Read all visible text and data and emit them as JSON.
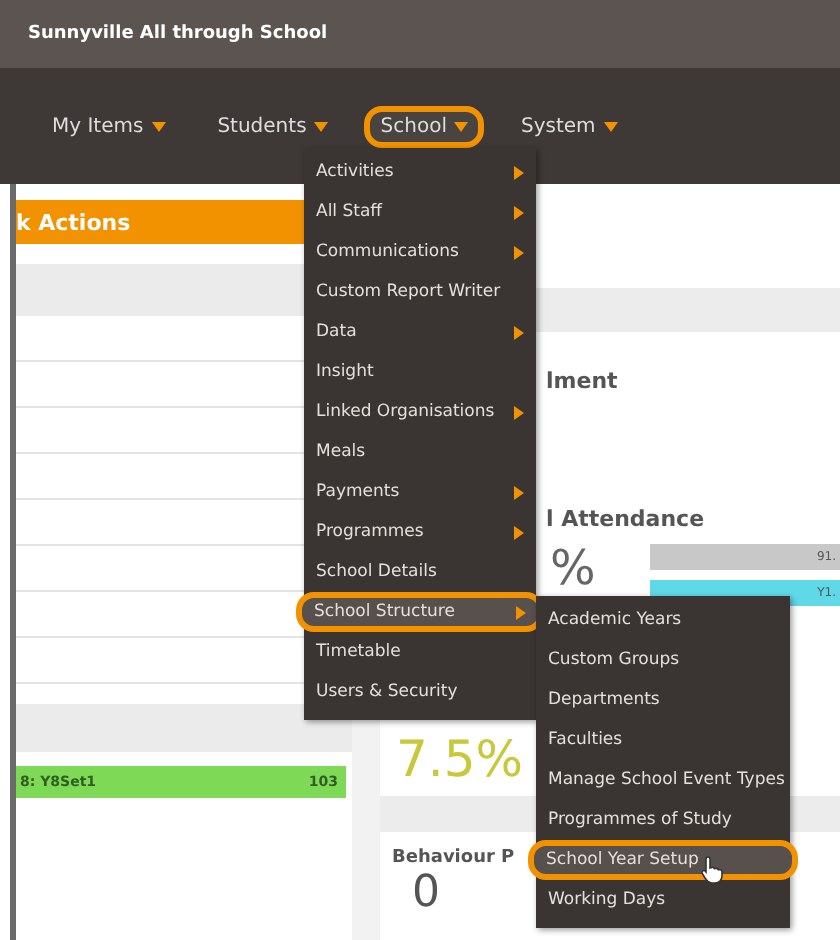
{
  "window": {
    "title": "Sunnyville All through School"
  },
  "nav": [
    {
      "label": "My Items",
      "highlighted": false
    },
    {
      "label": "Students",
      "highlighted": false
    },
    {
      "label": "School",
      "highlighted": true
    },
    {
      "label": "System",
      "highlighted": false
    }
  ],
  "left_panel": {
    "title": "k Actions",
    "group": {
      "label": "8: Y8Set1",
      "count": "103"
    }
  },
  "right_panel": {
    "enrolment_title": "lment",
    "attendance_title": "l Attendance",
    "attendance_value": "%",
    "bars": [
      {
        "label": "91.",
        "color": "#c8c8c8"
      },
      {
        "label": "Y1.",
        "color": "#5fd8e8"
      }
    ],
    "big_value": "7.5%",
    "behaviour_title": "Behaviour P",
    "behaviour_value": "0"
  },
  "menu": [
    {
      "label": "Activities",
      "has_submenu": true,
      "highlighted": false
    },
    {
      "label": "All Staff",
      "has_submenu": true,
      "highlighted": false
    },
    {
      "label": "Communications",
      "has_submenu": true,
      "highlighted": false
    },
    {
      "label": "Custom Report Writer",
      "has_submenu": false,
      "highlighted": false
    },
    {
      "label": "Data",
      "has_submenu": true,
      "highlighted": false
    },
    {
      "label": "Insight",
      "has_submenu": false,
      "highlighted": false
    },
    {
      "label": "Linked Organisations",
      "has_submenu": true,
      "highlighted": false
    },
    {
      "label": "Meals",
      "has_submenu": false,
      "highlighted": false
    },
    {
      "label": "Payments",
      "has_submenu": true,
      "highlighted": false
    },
    {
      "label": "Programmes",
      "has_submenu": true,
      "highlighted": false
    },
    {
      "label": "School Details",
      "has_submenu": false,
      "highlighted": false
    },
    {
      "label": "School Structure",
      "has_submenu": true,
      "highlighted": true
    },
    {
      "label": "Timetable",
      "has_submenu": false,
      "highlighted": false
    },
    {
      "label": "Users & Security",
      "has_submenu": false,
      "highlighted": false
    }
  ],
  "submenu": [
    {
      "label": "Academic Years",
      "highlighted": false
    },
    {
      "label": "Custom Groups",
      "highlighted": false
    },
    {
      "label": "Departments",
      "highlighted": false
    },
    {
      "label": "Faculties",
      "highlighted": false
    },
    {
      "label": "Manage School Event Types",
      "highlighted": false
    },
    {
      "label": "Programmes of Study",
      "highlighted": false
    },
    {
      "label": "School Year Setup",
      "highlighted": true
    },
    {
      "label": "Working Days",
      "highlighted": false
    }
  ]
}
